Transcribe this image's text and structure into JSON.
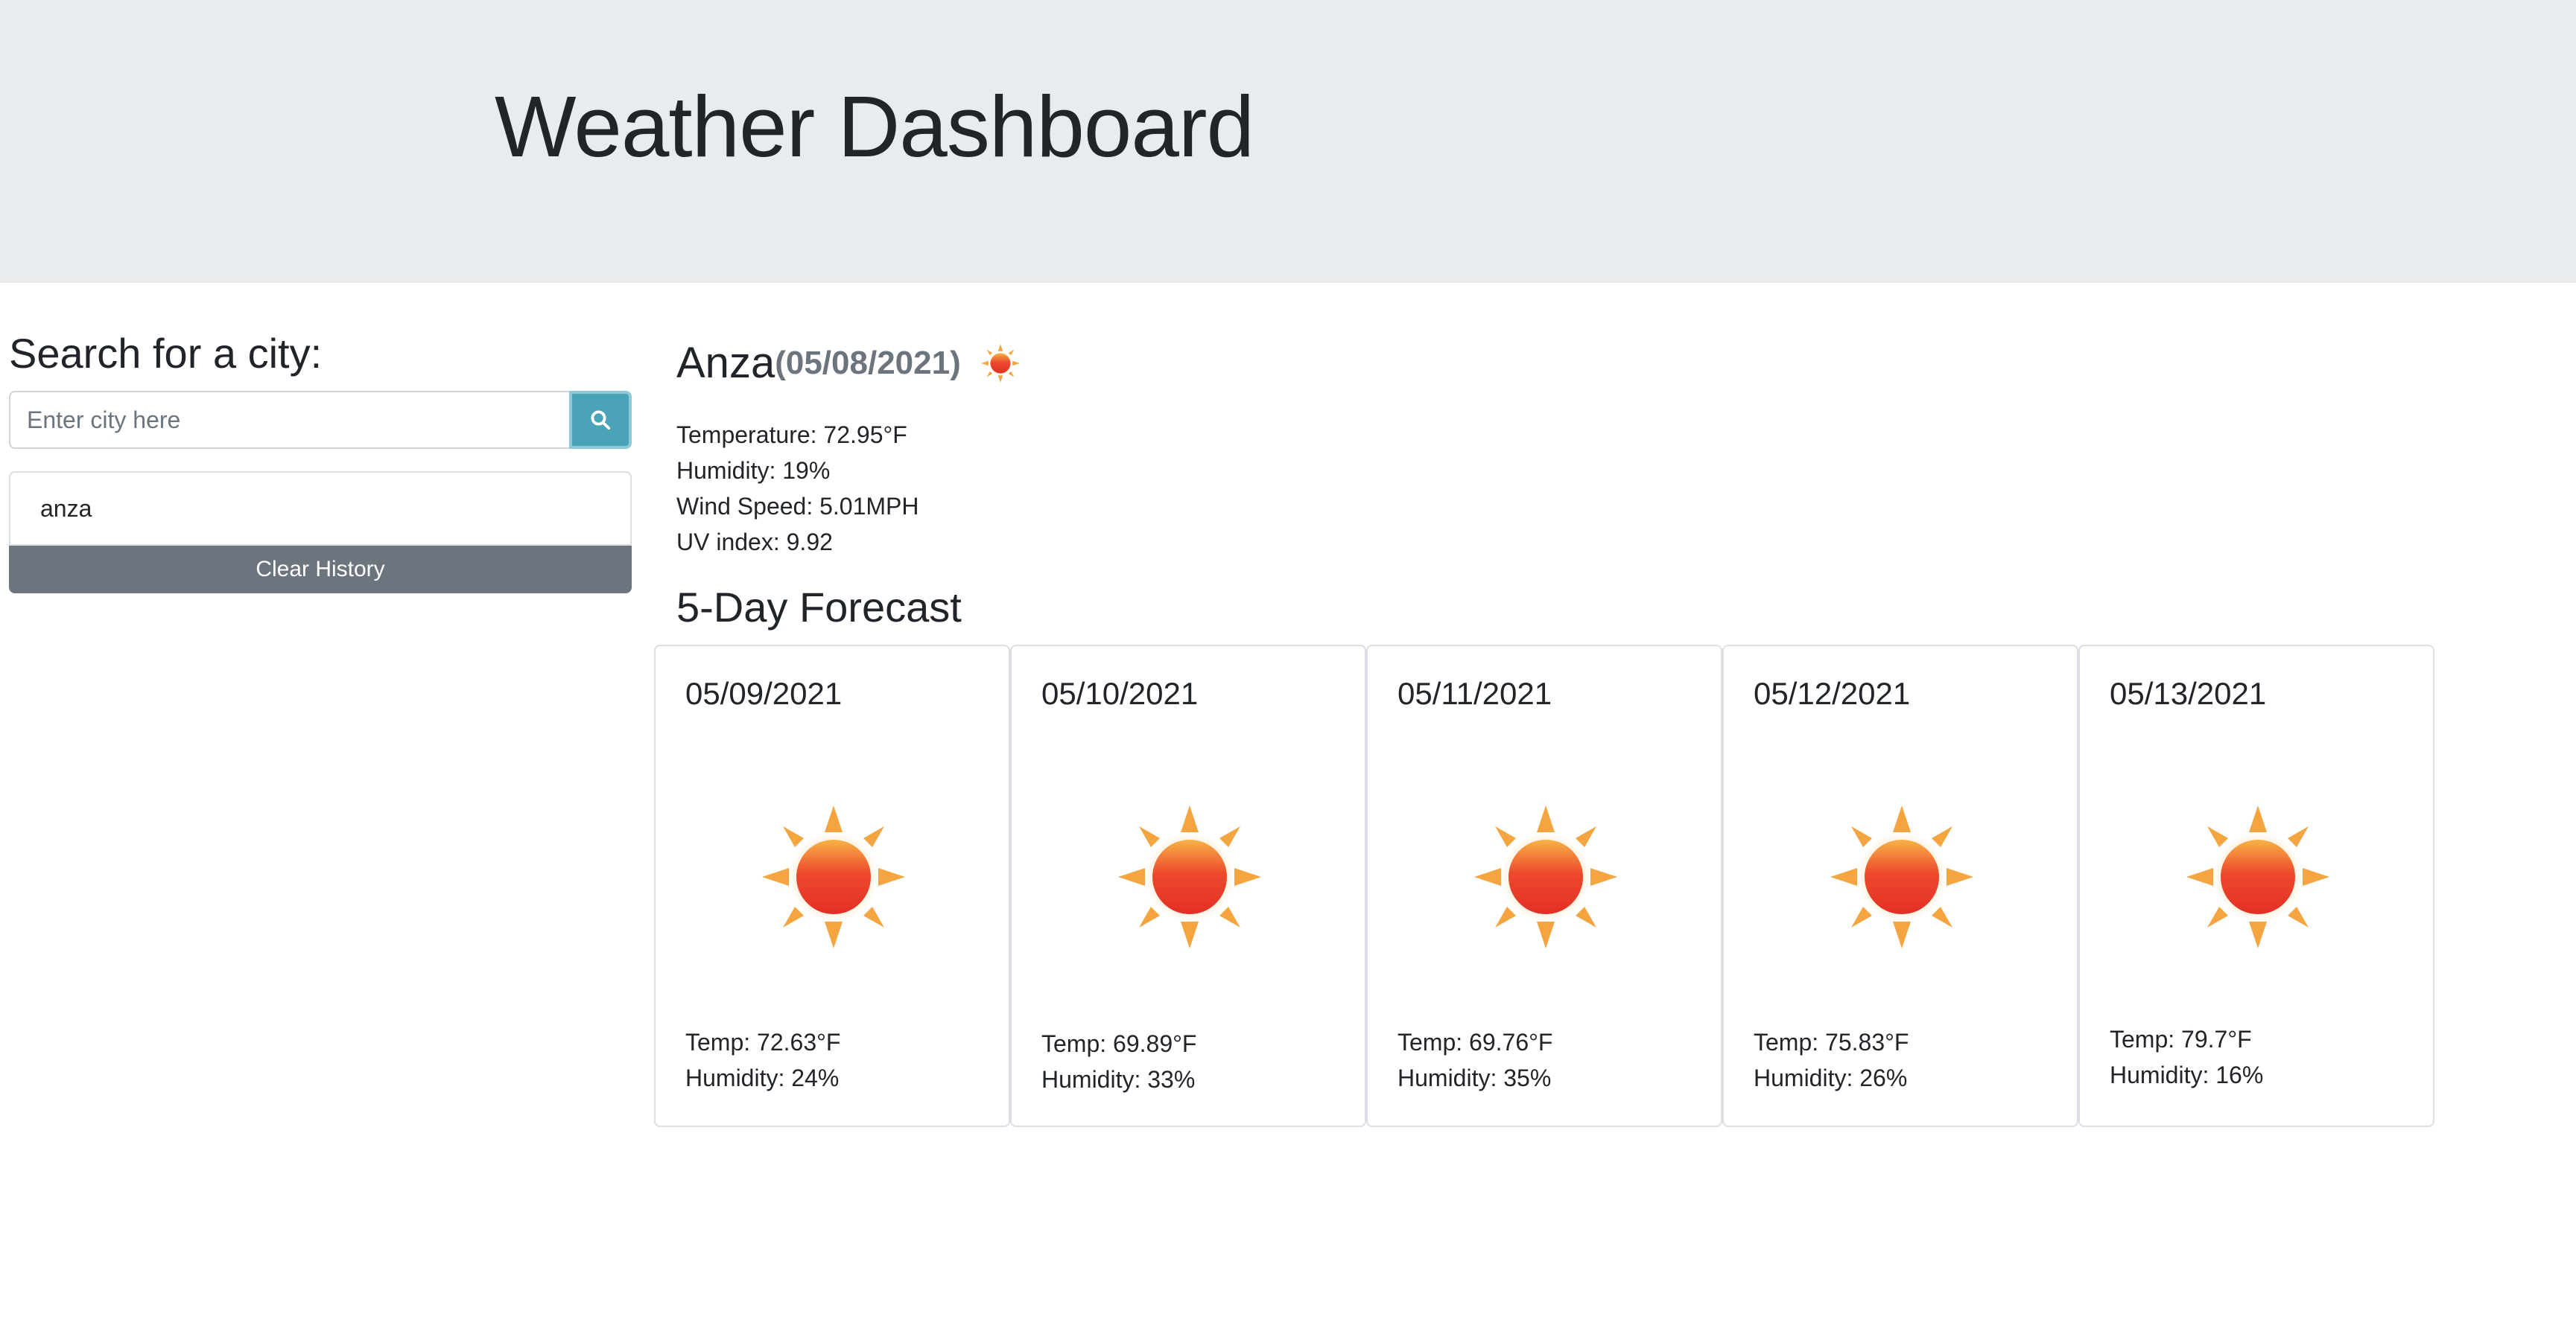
{
  "header": {
    "title": "Weather Dashboard"
  },
  "sidebar": {
    "heading": "Search for a city:",
    "search_placeholder": "Enter city here",
    "search_button_icon": "search-icon",
    "history": [
      "anza"
    ],
    "clear_label": "Clear History"
  },
  "current": {
    "city": "Anza",
    "date": "(05/08/2021)",
    "icon": "sun-icon",
    "temperature": "Temperature: 72.95°F",
    "humidity": "Humidity: 19%",
    "wind": "Wind Speed: 5.01MPH",
    "uv": "UV index: 9.92"
  },
  "forecast": {
    "heading": "5-Day Forecast",
    "days": [
      {
        "date": "05/09/2021",
        "icon": "sun-icon",
        "temp": "Temp: 72.63°F",
        "humidity": "Humidity: 24%"
      },
      {
        "date": "05/10/2021",
        "icon": "sun-icon",
        "temp": "Temp: 69.89°F",
        "humidity": "Humidity: 33%"
      },
      {
        "date": "05/11/2021",
        "icon": "sun-icon",
        "temp": "Temp: 69.76°F",
        "humidity": "Humidity: 35%"
      },
      {
        "date": "05/12/2021",
        "icon": "sun-icon",
        "temp": "Temp: 75.83°F",
        "humidity": "Humidity: 26%"
      },
      {
        "date": "05/13/2021",
        "icon": "sun-icon",
        "temp": "Temp: 79.7°F",
        "humidity": "Humidity: 16%"
      }
    ]
  },
  "colors": {
    "header_bg": "#e9ecef",
    "search_button": "#4aa3b8",
    "clear_button": "#6c757d",
    "sun_core": "#e8382a",
    "sun_rays": "#f4a540"
  }
}
